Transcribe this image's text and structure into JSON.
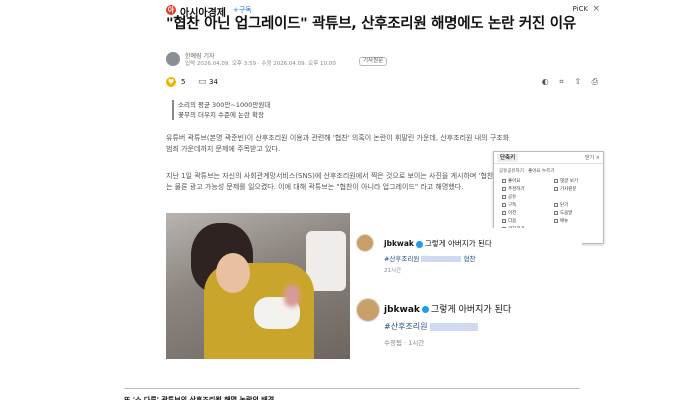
{
  "header": {
    "logo_letter": "아",
    "publisher": "아시아경제",
    "subscribe": "+구독",
    "pick": "PiCK",
    "close": "×"
  },
  "article": {
    "title": "\"협찬 아닌 업그레이드\" 곽튜브, 산후조리원 해명에도 논란 커진 이유",
    "author": "한예림 기자",
    "dates": "입력 2026.04.09. 오후 3:59 · 수정 2026.04.09. 오후 10:00",
    "byline_button": "기사원문",
    "likes": "5",
    "comments": "34",
    "action_icons": "◐ ⌗ ⇧ ⎙",
    "subheads": [
      "소리의 평균 300만~1000만원대",
      "꽃무의 더우지 수준에 논란 확장"
    ],
    "paragraphs": [
      "유튜버 곽튜브(본명 곽준빈)이 산후조리원 이용과 관련해 '협찬' 의혹이 논란이 휘말린 가운데, 산후조리원 내의 구조화 범죄 가운데까지 문제에 주목받고 있다.",
      "지난 1일 곽튜브는 자신의 사회관계망서비스(SNS)에 산후조리원에서 찍은 것으로 보이는 사진을 게시하며 '협찬' 여부는 물론 광고 가능성 문제를 일으켰다. 이에 대해 곽튜브는 \"협찬이 아니라 업그레이드\" 라고 해명했다."
    ]
  },
  "popup": {
    "tab": "단축키",
    "close": "닫기 ×",
    "row1": "공유공유하기 · 좋아요 누르기",
    "items": [
      "좋아요",
      "댓글 보기",
      "추천하기",
      "기사원문",
      "공유",
      "",
      "구독",
      "닫기",
      "이전",
      "도움말",
      "다음",
      "메뉴",
      "글자크기",
      "",
      "텍스트",
      ""
    ]
  },
  "instagram": {
    "top": {
      "username": "jbkwak",
      "caption": "그렇게 아버지가 된다",
      "tag": "#산후조리원",
      "tag_tail": "협찬",
      "time": "21시간"
    },
    "bottom": {
      "username": "jbkwak",
      "caption": "그렇게 아버지가 된다",
      "tag": "#산후조리원",
      "meta": "수정됨 · 1시간"
    }
  },
  "footer": {
    "text": "또 '소 다른' 곽튜브의 산후조리원 해명 논란의 배경"
  }
}
